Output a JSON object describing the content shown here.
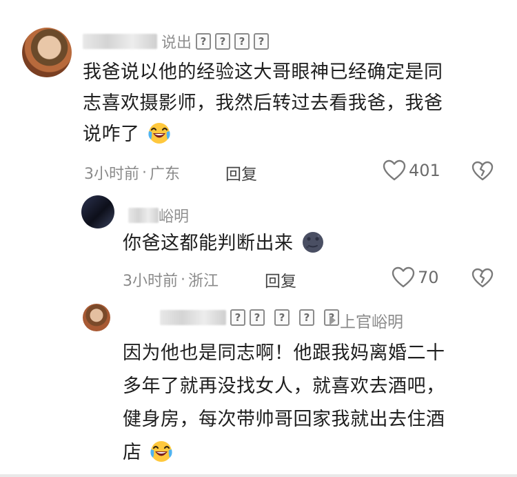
{
  "comments": [
    {
      "user": {
        "name_visible": "说出"
      },
      "text_lines": [
        "我爸说以他的经验这大哥眼神已经确定是同",
        "志喜欢摄影师，我然后转过去看我爸，我爸",
        "说咋了"
      ],
      "emoji": "laugh-cry-emoji",
      "time": "3小时前",
      "location": "广东",
      "reply_label": "回复",
      "likes": "401"
    },
    {
      "user": {
        "name_visible": "峪明"
      },
      "text_lines": [
        "你爸这都能判断出来"
      ],
      "emoji": "moon-emoji",
      "time": "3小时前",
      "location": "浙江",
      "reply_label": "回复",
      "likes": "70"
    },
    {
      "user": {
        "name_visible": ""
      },
      "reply_to": "上官峪明",
      "text_lines": [
        "因为他也是同志啊！他跟我妈离婚二十",
        "多年了就再没找女人，就喜欢去酒吧，",
        "健身房，每次带帅哥回家我就出去住酒",
        "店"
      ],
      "emoji": "laugh-cry-emoji"
    }
  ],
  "separator": "·",
  "unknown_glyph": "?",
  "colors": {
    "text": "#1e1e1e",
    "meta": "#8a8a8a",
    "icon": "#7a7a7a"
  }
}
